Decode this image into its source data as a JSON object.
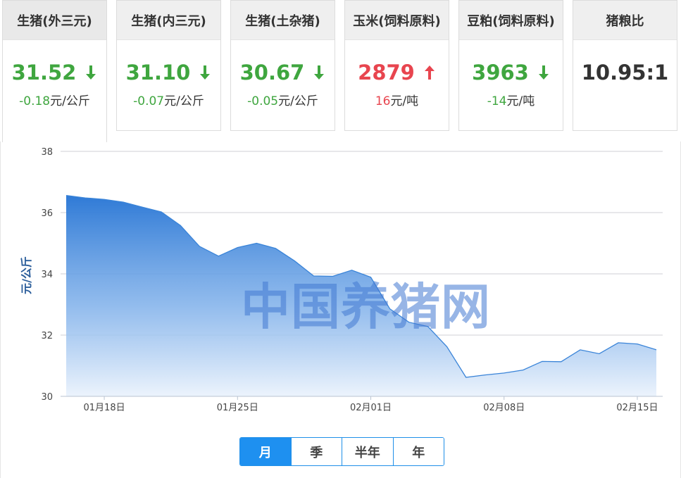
{
  "cards": [
    {
      "title": "生猪(外三元)",
      "price": "31.52",
      "direction": "down",
      "change": "-0.18",
      "unit": "元/公斤",
      "color": "#3fa63f"
    },
    {
      "title": "生猪(内三元)",
      "price": "31.10",
      "direction": "down",
      "change": "-0.07",
      "unit": "元/公斤",
      "color": "#3fa63f"
    },
    {
      "title": "生猪(土杂猪)",
      "price": "30.67",
      "direction": "down",
      "change": "-0.05",
      "unit": "元/公斤",
      "color": "#3fa63f"
    },
    {
      "title": "玉米(饲料原料)",
      "price": "2879",
      "direction": "up",
      "change": "16",
      "unit": "元/吨",
      "color": "#e8454f"
    },
    {
      "title": "豆粕(饲料原料)",
      "price": "3963",
      "direction": "down",
      "change": "-14",
      "unit": "元/吨",
      "color": "#3fa63f"
    },
    {
      "title": "猪粮比",
      "price": "10.95:1",
      "direction": "none",
      "change": "",
      "unit": "",
      "color": "#333333"
    }
  ],
  "watermark": "中国养猪网",
  "range_tabs": {
    "month": "月",
    "quarter": "季",
    "half_year": "半年",
    "year": "年",
    "active": "month"
  },
  "chart_data": {
    "type": "area",
    "ylabel": "元/公斤",
    "ylim": [
      30,
      38
    ],
    "yticks": [
      30,
      32,
      34,
      36,
      38
    ],
    "grid": true,
    "xlim": [
      0,
      31
    ],
    "xticks": [
      {
        "x": 2,
        "label": "01月18日"
      },
      {
        "x": 9,
        "label": "01月25日"
      },
      {
        "x": 16,
        "label": "02月01日"
      },
      {
        "x": 23,
        "label": "02月08日"
      },
      {
        "x": 30,
        "label": "02月15日"
      }
    ],
    "color": "#3a84d8",
    "series": [
      {
        "values": [
          36.56,
          36.48,
          36.43,
          36.34,
          36.18,
          36.02,
          35.58,
          34.9,
          34.58,
          34.86,
          35.0,
          34.83,
          34.42,
          33.93,
          33.92,
          34.12,
          33.89,
          32.86,
          32.42,
          32.28,
          31.62,
          30.62,
          30.7,
          30.76,
          30.86,
          31.14,
          31.13,
          31.52,
          31.39,
          31.75,
          31.71,
          31.52
        ]
      }
    ]
  }
}
